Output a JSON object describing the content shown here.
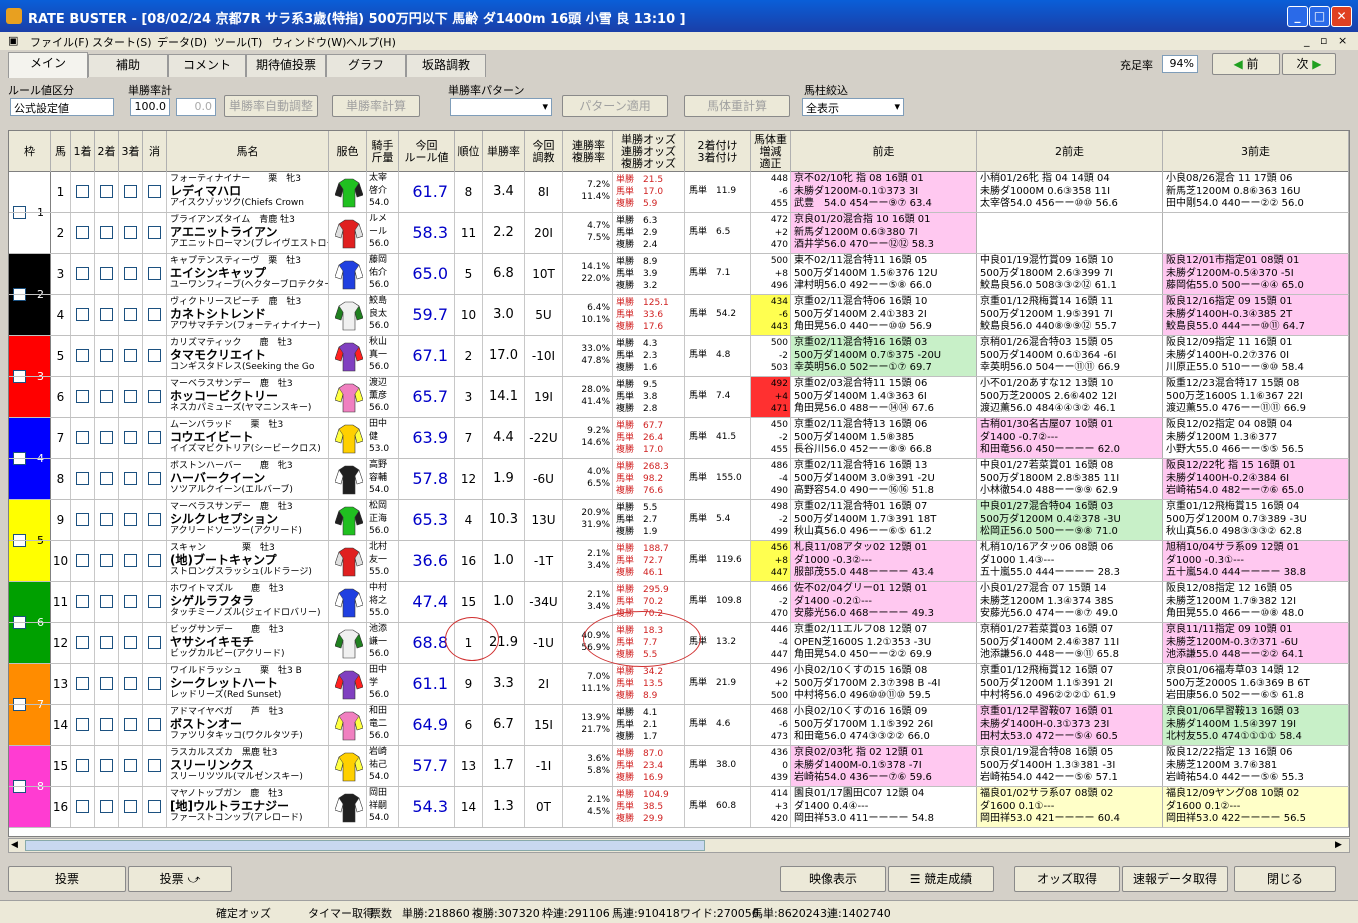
{
  "window": {
    "title": "RATE BUSTER - [08/02/24 京都7R サラ系3歳(特指) 500万円以下 馬齢 ダ1400m 16頭 小雪 良 13:10 ]"
  },
  "menu": [
    "ファイル(F)",
    "スタート(S)",
    "データ(D)",
    "ツール(T)",
    "ウィンドウ(W)",
    "ヘルプ(H)"
  ],
  "tabs": [
    "メイン",
    "補助",
    "コメント",
    "期待値投票",
    "グラフ",
    "坂路調教"
  ],
  "fill_rate": {
    "label": "充足率",
    "value": "94%"
  },
  "nav": {
    "prev": "前",
    "next": "次"
  },
  "controls": {
    "rule_label": "ルール値区分",
    "rule_value": "公式設定値",
    "winrate_label": "単勝率計",
    "winrate_value": "100.0",
    "winrate_value2": "0.0",
    "btn_auto": "単勝率自動調整",
    "btn_calc": "単勝率計算",
    "pattern_label": "単勝率パターン",
    "btn_pattern": "パターン適用",
    "btn_weight": "馬体重計算",
    "filter_label": "馬柱絞込",
    "filter_value": "全表示"
  },
  "headers": [
    "枠",
    "馬",
    "1着",
    "2着",
    "3着",
    "消",
    "馬名",
    "服色",
    "騎手\n斤量",
    "今回\nルール値",
    "順位",
    "単勝率",
    "今回\n調教",
    "連勝率\n複勝率",
    "単勝オッズ\n連勝オッズ\n複勝オッズ",
    "2着付け\n3着付け",
    "馬体重\n増減\n適正",
    "前走",
    "2前走",
    "3前走"
  ],
  "horses": [
    {
      "no": "1",
      "waku": "1",
      "sire": "フォーティナイナー　　栗　牝3",
      "name": "レディマハロ",
      "dam": "アイスクゾッツク(Chiefs Crown",
      "jockey": "太宰\n啓介\n54.0",
      "rule": "61.7",
      "rank": "8",
      "wr": "3.4",
      "chokyo": "8I",
      "rates": "7.2%\n11.4%",
      "odds": "単勝　21.5\n馬単　17.0\n複勝　5.9",
      "tsuke": "馬単　11.9",
      "weight": "448\n-6\n455",
      "p1": "京不02/10牝 指 08 16頭 01\n未勝ダ1200M-0.1①373 3I\n武豊　54.0 454ーー⑨⑦ 63.4",
      "p1c": "#ffc8f0",
      "p2": "小稍01/26牝 指 04 14頭 04\n未勝ダ1000M 0.6③358 11I\n太宰啓54.0 456ーー⑩⑩ 56.6",
      "p2c": "#ffffff",
      "p3": "小良08/26混合 11 17頭 06\n新馬芝1200M 0.8⑥363 16U\n田中剛54.0 440ーー②② 56.0",
      "p3c": "#ffffff"
    },
    {
      "no": "2",
      "waku": "1",
      "sire": "ブライアンズタイム　青鹿 牡3",
      "name": "アエニットライアン",
      "dam": "アエニットローマン(ブレイヴエストローマン)",
      "jockey": "ルメ\nール\n56.0",
      "rule": "58.3",
      "rank": "11",
      "wr": "2.2",
      "chokyo": "20I",
      "rates": "4.7%\n7.5%",
      "odds": "単勝　6.3\n馬単　2.9\n複勝　2.4",
      "tsuke": "馬単　6.5",
      "weight": "472\n+2\n470",
      "p1": "京良01/20混合指 10 16頭 01\n新馬ダ1200M 0.6③380 7I\n酒井学56.0 470ーー⑫⑫ 58.3",
      "p1c": "#ffc8f0",
      "p2": "",
      "p2c": "#ffffff",
      "p3": "",
      "p3c": "#ffffff"
    },
    {
      "no": "3",
      "waku": "2",
      "sire": "キャプテンスティーヴ　栗　牡3",
      "name": "エイシンキャップ",
      "dam": "ユーワンフィーブ(ヘクターブロテクター)",
      "jockey": "藤岡\n佑介\n56.0",
      "rule": "65.0",
      "rank": "5",
      "wr": "6.8",
      "chokyo": "10T",
      "rates": "14.1%\n22.0%",
      "odds": "単勝　8.9\n馬単　3.9\n複勝　3.2",
      "tsuke": "馬単　7.1",
      "weight": "500\n+8\n496",
      "p1": "東不02/11混合特11 16頭 05\n500万ダ1400M 1.5⑥376 12U\n津村明56.0 492ーー⑤⑧ 66.0",
      "p1c": "#ffffff",
      "p2": "中良01/19混竹賞09 16頭 10\n500万ダ1800M 2.6③399 7I\n鮫島良56.0 508③③②⑫ 61.1",
      "p2c": "#ffffff",
      "p3": "阪良12/01市指定01 08頭 01\n未勝ダ1200M-0.5④370 -5I\n藤岡佑55.0 500ーー④④ 65.0",
      "p3c": "#ffc8f0"
    },
    {
      "no": "4",
      "waku": "2",
      "sire": "ヴィクトリースピーチ　鹿　牡3",
      "name": "カネトシトレンド",
      "dam": "アワサマチテン(フォーティナイナー)",
      "jockey": "鮫島\n良太\n56.0",
      "rule": "59.7",
      "rank": "10",
      "wr": "3.0",
      "chokyo": "5U",
      "rates": "6.4%\n10.1%",
      "odds": "単勝　125.1\n馬単　33.6\n複勝　17.6",
      "tsuke": "馬単　54.2",
      "weight": "434\n-6\n443",
      "wcolor": "#ffff50",
      "p1": "京重02/11混合特06 16頭 10\n500万ダ1400M 2.4①383 2I\n角田晃56.0 440ーー⑩⑩ 56.9",
      "p1c": "#ffffff",
      "p2": "京重01/12飛梅賞14 16頭 11\n500万ダ1200M 1.9⑤391 7I\n鮫島良56.0 440⑧⑨⑨⑫ 55.7",
      "p2c": "#ffffff",
      "p3": "阪良12/16指定 09 15頭 01\n未勝ダ1400H-0.3④385 2T\n鮫島良55.0 444ーー⑩⑪ 64.7",
      "p3c": "#ffc8f0"
    },
    {
      "no": "5",
      "waku": "3",
      "sire": "カリズマティック　　鹿　牡3",
      "name": "タマモクリエイト",
      "dam": "コンギスタドレス(Seeking the Go",
      "jockey": "秋山\n真一\n56.0",
      "rule": "67.1",
      "rank": "2",
      "wr": "17.0",
      "chokyo": "-10I",
      "rates": "33.0%\n47.8%",
      "odds": "単勝　4.3\n馬単　2.3\n複勝　1.6",
      "tsuke": "馬単　4.8",
      "weight": "500\n-2\n503",
      "p1": "京重02/11混合特16 16頭 03\n500万ダ1400M 0.7⑤375 -20U\n幸英明56.0 502ーー①⑦ 69.7",
      "p1c": "#c8f0c8",
      "p2": "京稍01/26混合特03 15頭 05\n500万ダ1400M 0.6①364 -6I\n幸英明56.0 504ーー⑪⑪ 66.9",
      "p2c": "#ffffff",
      "p3": "阪良12/09指定 11 16頭 01\n未勝ダ1400H-0.2⑦376 0I\n川原正55.0 510ーー⑨⑩ 58.4",
      "p3c": "#ffffff"
    },
    {
      "no": "6",
      "waku": "3",
      "sire": "マーベラスサンデー　鹿　牡3",
      "name": "ホッコービクトリー",
      "dam": "ネスカパミューズ(ヤマニンスキー)",
      "jockey": "渡辺\n薫彦\n56.0",
      "rule": "65.7",
      "rank": "3",
      "wr": "14.1",
      "chokyo": "19I",
      "rates": "28.0%\n41.4%",
      "odds": "単勝　9.5\n馬単　3.8\n複勝　2.8",
      "tsuke": "馬単　7.4",
      "weight": "492\n+4\n471",
      "wcolor": "#ff3030",
      "p1": "京重02/03混合特11 15頭 06\n500万ダ1400M 1.4③363 6I\n角田晃56.0 488ーー⑭⑭ 67.6",
      "p1c": "#ffffff",
      "p2": "小不01/20あすな12 13頭 10\n500万芝2000S 2.6⑥402 12I\n渡辺薫56.0 484④④③② 46.1",
      "p2c": "#ffffff",
      "p3": "阪重12/23混合特17 15頭 08\n500万芝1600S 1.1⑥367 22I\n渡辺薫55.0 476ーー⑪⑪ 66.9",
      "p3c": "#ffffff"
    },
    {
      "no": "7",
      "waku": "4",
      "sire": "ムーンバラッド　　栗　牡3",
      "name": "コウエイビート",
      "dam": "イイズマビクトリア(シービークロス)",
      "jockey": "田中\n健\n53.0",
      "rule": "63.9",
      "rank": "7",
      "wr": "4.4",
      "chokyo": "-22U",
      "rates": "9.2%\n14.6%",
      "odds": "単勝　67.7\n馬単　26.4\n複勝　17.0",
      "tsuke": "馬単　41.5",
      "weight": "450\n-2\n455",
      "p1": "京重02/11混合特13 16頭 06\n500万ダ1400M 1.5⑧385\n長谷川56.0 452ーー⑧⑨ 66.8",
      "p1c": "#ffffff",
      "p2": "古稍01/30名古屋07 10頭 01\nダ1400 -0.7②---\n和田竜56.0 450ーーーー 62.0",
      "p2c": "#ffc8f0",
      "p3": "阪良12/02指定 04 08頭 04\n未勝ダ1200M 1.3⑥377\n小野大55.0 466ーー⑤⑤ 56.5",
      "p3c": "#ffffff"
    },
    {
      "no": "8",
      "waku": "4",
      "sire": "ボストンハーバー　　鹿　牝3",
      "name": "ハーバークイーン",
      "dam": "ソツアルクイーン(エルバーブ)",
      "jockey": "高野\n容輔\n54.0",
      "rule": "57.8",
      "rank": "12",
      "wr": "1.9",
      "chokyo": "-6U",
      "rates": "4.0%\n6.5%",
      "odds": "単勝　268.3\n馬単　98.2\n複勝　76.6",
      "tsuke": "馬単　155.0",
      "weight": "486\n-4\n490",
      "p1": "京重02/11混合特16 16頭 13\n500万ダ1400M 3.0⑨391 -2U\n高野容54.0 490ーー⑯⑯ 51.8",
      "p1c": "#ffffff",
      "p2": "中良01/27若菜賞01 16頭 08\n500万ダ1800M 2.8⑤385 11I\n小林徹54.0 488ーー⑨⑨ 62.9",
      "p2c": "#ffffff",
      "p3": "阪良12/22牝 指 15 16頭 01\n未勝ダ1400H-0.2④384 6I\n岩崎祐54.0 482ーー⑦⑥ 65.0",
      "p3c": "#ffc8f0"
    },
    {
      "no": "9",
      "waku": "5",
      "sire": "マーベラスサンデー　鹿　牡3",
      "name": "シルクレセプション",
      "dam": "アクリードソーツー(アクリード)",
      "jockey": "松岡\n正海\n56.0",
      "rule": "65.3",
      "rank": "4",
      "wr": "10.3",
      "chokyo": "13U",
      "rates": "20.9%\n31.9%",
      "odds": "単勝　5.5\n馬単　2.7\n複勝　1.9",
      "tsuke": "馬単　5.4",
      "weight": "498\n-2\n499",
      "p1": "京重02/11混合特01 16頭 07\n500万ダ1400M 1.7③391 18T\n秋山真56.0 496ーー⑥⑤ 61.2",
      "p1c": "#ffffff",
      "p2": "中良01/27混合特04 16頭 03\n500万ダ1200M 0.4②378 -3U\n松岡正56.0 500ーー⑨⑧ 71.0",
      "p2c": "#c8f0c8",
      "p3": "京重01/12飛梅賞15 16頭 04\n500万ダ1200M 0.7③389 -3U\n秋山真56.0 498③③③② 62.8",
      "p3c": "#ffffff"
    },
    {
      "no": "10",
      "waku": "5",
      "sire": "スキャン　　　　栗　牡3",
      "name": "(地)ブートキャンプ",
      "dam": "ストロングスラッシュ(ルドラージ)",
      "jockey": "北村\n友一\n55.0",
      "rule": "36.6",
      "rank": "16",
      "wr": "1.0",
      "chokyo": "-1T",
      "rates": "2.1%\n3.4%",
      "odds": "単勝　188.7\n馬単　72.7\n複勝　46.1",
      "tsuke": "馬単　119.6",
      "weight": "456\n+8\n447",
      "wcolor": "#ffff50",
      "p1": "札良11/08アタッ02 12頭 01\nダ1000 -0.3②---\n服部茂55.0 448ーーーー 43.4",
      "p1c": "#ffc8f0",
      "p2": "札稍10/16アタッ06 08頭 06\nダ1000 1.4③---\n五十嵐55.0 444ーーーー 28.3",
      "p2c": "#ffffff",
      "p3": "旭稍10/04サラ系09 12頭 01\nダ1000 -0.3①---\n五十嵐54.0 444ーーーー 38.8",
      "p3c": "#ffc8f0"
    },
    {
      "no": "11",
      "waku": "6",
      "sire": "ホワイトマズル　　鹿　牡3",
      "name": "シゲルラフタラ",
      "dam": "タッチミーノズル(ジェイドロバリー)",
      "jockey": "中村\n将之\n55.0",
      "rule": "47.4",
      "rank": "15",
      "wr": "1.0",
      "chokyo": "-34U",
      "rates": "2.1%\n3.4%",
      "odds": "単勝　295.9\n馬単　70.2\n複勝　70.2",
      "tsuke": "馬単　109.8",
      "weight": "466\n-2\n470",
      "p1": "佐不02/04グリー01 12頭 01\nダ1400 -0.2①---\n安藤光56.0 468ーーーー 49.3",
      "p1c": "#ffc8f0",
      "p2": "小良01/27混合 07 15頭 14\n未勝芝1200M 1.3④374 38S\n安藤光56.0 474ーー⑧⑦ 49.0",
      "p2c": "#ffffff",
      "p3": "阪良12/08指定 12 16頭 05\n未勝芝1200M 1.7⑨382 12I\n角田晃55.0 466ーー⑩⑧ 48.0",
      "p3c": "#ffffff"
    },
    {
      "no": "12",
      "waku": "6",
      "sire": "ビッグサンデー　　鹿　牡3",
      "name": "ヤサシイキモチ",
      "dam": "ビッグカルビー(アクリード)",
      "jockey": "池添\n謙一\n56.0",
      "rule": "68.8",
      "rank": "1",
      "wr": "21.9",
      "chokyo": "-1U",
      "rates": "40.9%\n56.9%",
      "odds": "単勝　18.3\n馬単　7.7\n複勝　5.5",
      "tsuke": "馬単　13.2",
      "weight": "446\n-4\n447",
      "p1": "京重02/11エルフ08 12頭 07\nOPEN芝1600S 1.2①353 -3U\n角田晃54.0 450ーー②② 69.9",
      "p1c": "#ffffff",
      "p2": "京稍01/27若菜賞03 16頭 07\n500万ダ1400M 2.4⑥387 11I\n池添謙56.0 448ーー⑨⑪ 65.8",
      "p2c": "#ffffff",
      "p3": "京良11/11指定 09 10頭 01\n未勝芝1200M-0.3⑦371 -6U\n池添謙55.0 448ーー②② 64.1",
      "p3c": "#ffc8f0"
    },
    {
      "no": "13",
      "waku": "7",
      "sire": "ワイルドラッシュ　　栗　牡3 B",
      "name": "シークレットハート",
      "dam": "レッドリーズ(Red Sunset)",
      "jockey": "田中\n学\n56.0",
      "rule": "61.1",
      "rank": "9",
      "wr": "3.3",
      "chokyo": "2I",
      "rates": "7.0%\n11.1%",
      "odds": "単勝　34.2\n馬単　13.5\n複勝　8.9",
      "tsuke": "馬単　21.9",
      "weight": "496\n+2\n500",
      "p1": "小良02/10くすの15 16頭 08\n500万ダ1700M 2.3⑦398 B -4I\n中村将56.0 496⑩⑩⑪⑩ 59.5",
      "p1c": "#ffffff",
      "p2": "京重01/12飛梅賞12 16頭 07\n500万ダ1200M 1.1⑤391 2I\n中村将56.0 496②②②① 61.9",
      "p2c": "#ffffff",
      "p3": "京良01/06福寿草03 14頭 12\n500万芝2000S 1.6③369 B 6T\n岩田康56.0 502ーー⑥⑤ 61.8",
      "p3c": "#ffffff"
    },
    {
      "no": "14",
      "waku": "7",
      "sire": "アドマイヤベガ　　芦　牡3",
      "name": "ボストンオー",
      "dam": "ファツリタキッコ(ワクルタツチ)",
      "jockey": "和田\n竜二\n56.0",
      "rule": "64.9",
      "rank": "6",
      "wr": "6.7",
      "chokyo": "15I",
      "rates": "13.9%\n21.7%",
      "odds": "単勝　4.1\n馬単　2.1\n複勝　1.7",
      "tsuke": "馬単　4.6",
      "weight": "468\n-6\n473",
      "p1": "小良02/10くすの16 16頭 09\n500万ダ1700M 1.1⑤392 26I\n和田竜56.0 474③③②② 66.0",
      "p1c": "#ffffff",
      "p2": "京重01/12早習鞍07 16頭 01\n未勝ダ1400H-0.3①373 23I\n田村太53.0 472ーー⑤④ 60.5",
      "p2c": "#ffc8f0",
      "p3": "京良01/06早習鞍13 16頭 03\n未勝ダ1400M 1.5④397 19I\n北村友55.0 474①①①① 58.4",
      "p3c": "#c8f0c8"
    },
    {
      "no": "15",
      "waku": "8",
      "sire": "ラスカルスズカ　黒鹿 牡3",
      "name": "スリーリンクス",
      "dam": "スリーリツツル(マルゼンスキー)",
      "jockey": "岩崎\n祐己\n54.0",
      "rule": "57.7",
      "rank": "13",
      "wr": "1.7",
      "chokyo": "-1I",
      "rates": "3.6%\n5.8%",
      "odds": "単勝　87.0\n馬単　23.4\n複勝　16.9",
      "tsuke": "馬単　38.0",
      "weight": "436\n0\n439",
      "p1": "京良02/03牝 指 02 12頭 01\n未勝ダ1400M-0.1⑤378 -7I\n岩崎祐54.0 436ーー⑦⑥ 59.6",
      "p1c": "#ffc8f0",
      "p2": "京良01/19混合特08 16頭 05\n500万ダ1400H 1.3③381 -3I\n岩崎祐54.0 442ーー⑤⑥ 57.1",
      "p2c": "#ffffff",
      "p3": "阪良12/22指定 13 16頭 06\n未勝芝1200M 3.7⑥381\n岩崎祐54.0 442ーー⑤⑥ 55.3",
      "p3c": "#ffffff"
    },
    {
      "no": "16",
      "waku": "8",
      "sire": "マヤノトップガン　鹿　牡3",
      "name": "[地]ウルトラエナジー",
      "dam": "ファーストコンップ(アレロード)",
      "jockey": "岡田\n祥嗣\n54.0",
      "rule": "54.3",
      "rank": "14",
      "wr": "1.3",
      "chokyo": "0T",
      "rates": "2.1%\n4.5%",
      "odds": "単勝　104.9\n馬単　38.5\n複勝　29.9",
      "tsuke": "馬単　60.8",
      "weight": "414\n+3\n420",
      "p1": "園良01/17園田C07 12頭 04\nダ1400 0.4④---\n岡田祥53.0 411ーーーー 54.8",
      "p1c": "#ffffff",
      "p2": "福良01/02サラ系07 08頭 02\nダ1600 0.1①---\n岡田祥53.0 421ーーーー 60.4",
      "p2c": "#ffffc8",
      "p3": "福良12/09ヤング08 10頭 02\nダ1600 0.1②---\n岡田祥53.0 422ーーーー 56.5",
      "p3c": "#ffffc8"
    }
  ],
  "bottom_buttons": [
    "投票",
    "投票 ⤻",
    "映像表示",
    "競走成績",
    "オッズ取得",
    "速報データ取得",
    "閉じる"
  ],
  "status": [
    "確定オッズ",
    "タイマー取得",
    "票数",
    "単勝:218860",
    "複勝:307320",
    "枠連:291106",
    "馬連:910418",
    "ワイド:270056",
    "馬単:862024",
    "3連:1402740"
  ],
  "colors": {
    "waku": [
      "#ffffff",
      "#000000",
      "#ff0000",
      "#0000ff",
      "#ffff00",
      "#00a000",
      "#ff8c00",
      "#ff3cd2"
    ]
  }
}
